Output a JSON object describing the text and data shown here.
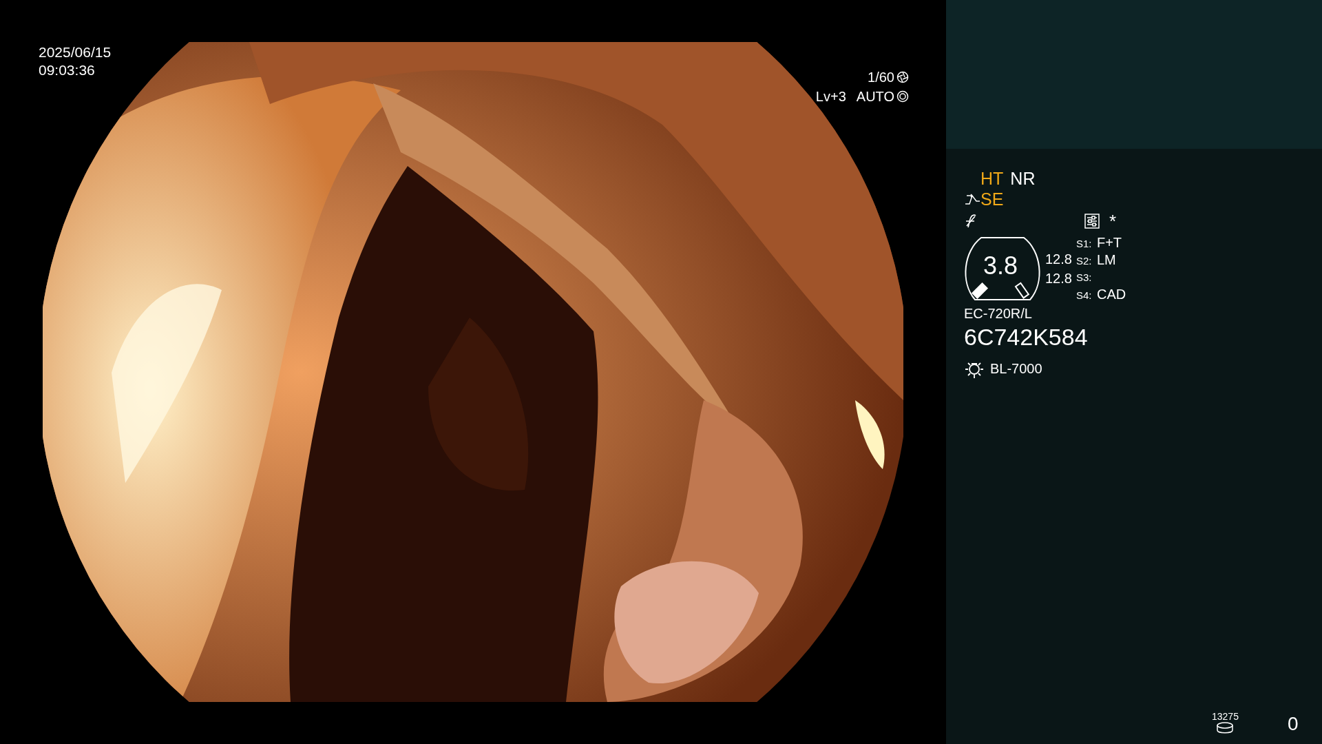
{
  "timestamp": {
    "date": "2025/06/15",
    "time": "09:03:36"
  },
  "exposure": {
    "shutter": "1/60",
    "level": "Lv+3",
    "mode": "AUTO"
  },
  "modes": [
    {
      "label": "HT",
      "color": "#f0a818"
    },
    {
      "label": "NR",
      "color": "#ffffff"
    }
  ],
  "structure": {
    "label": "SE",
    "color": "#f0a818"
  },
  "marker": "*",
  "gauge": {
    "value": "3.8",
    "readings": [
      "12.8",
      "12.8"
    ]
  },
  "switches": [
    {
      "label": "S1:",
      "value": "F+T"
    },
    {
      "label": "S2:",
      "value": "LM"
    },
    {
      "label": "S3:"
    },
    {
      "label": "S4:",
      "value": "CAD"
    }
  ],
  "scope": {
    "model": "EC-720R/L",
    "serial": "6C742K584"
  },
  "light": {
    "model": "BL-7000"
  },
  "storage": {
    "count": "13275"
  },
  "counter": "0"
}
